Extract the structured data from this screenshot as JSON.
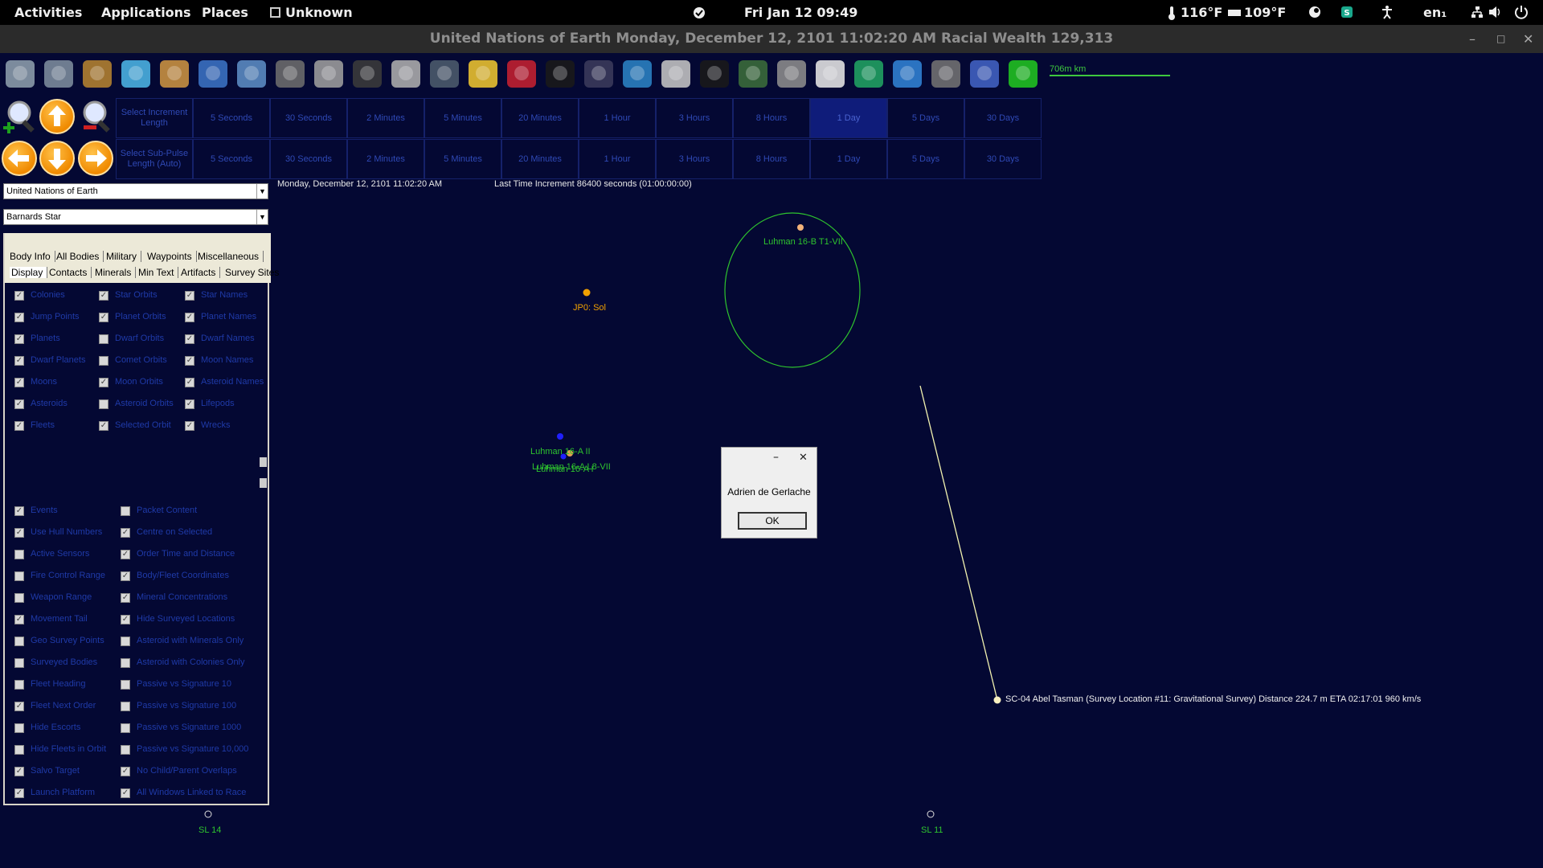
{
  "topbar": {
    "activities": "Activities",
    "applications": "Applications",
    "places": "Places",
    "window_app": "Unknown",
    "clock": "Fri Jan 12  09:49",
    "temp1": "116°F",
    "temp2": "109°F",
    "lang": "en₁"
  },
  "window": {
    "title": "United Nations of Earth   Monday, December 12, 2101 11:02:20 AM   Racial Wealth 129,313"
  },
  "scale": {
    "label": "706m km"
  },
  "toolbar_icons": [
    "home-icon",
    "industry-icon",
    "mining-cart-icon",
    "research-flask-icon",
    "wealth-bag-icon",
    "blueprint-icon",
    "design-icon",
    "ship-icon",
    "missile-icon",
    "ground-unit-icon",
    "walker-icon",
    "commander-icon",
    "medal-star-icon",
    "flag-uk-icon",
    "system-map-icon",
    "galaxy-icon",
    "planet-earth-icon",
    "alien-icon",
    "eye-icon",
    "intel-icon",
    "government-icon",
    "calendar-icon",
    "refresh-icon",
    "save-icon",
    "settings-gear-icon",
    "crystal-ball-icon",
    "green-orb-icon"
  ],
  "time_rows": [
    {
      "label": "Select Increment Length",
      "cells": [
        "5 Seconds",
        "30 Seconds",
        "2 Minutes",
        "5 Minutes",
        "20 Minutes",
        "1 Hour",
        "3 Hours",
        "8 Hours",
        "1 Day",
        "5 Days",
        "30 Days"
      ],
      "selected": 8
    },
    {
      "label": "Select Sub-Pulse Length (Auto)",
      "cells": [
        "5 Seconds",
        "30 Seconds",
        "2 Minutes",
        "5 Minutes",
        "20 Minutes",
        "1 Hour",
        "3 Hours",
        "8 Hours",
        "1 Day",
        "5 Days",
        "30 Days"
      ],
      "selected": -1
    }
  ],
  "selectors": {
    "race": "United Nations of Earth",
    "system": "Barnards Star"
  },
  "status": {
    "date": "Monday, December 12, 2101 11:02:20 AM",
    "increment": "Last Time Increment 86400 seconds (01:00:00:00)"
  },
  "tabs_row1": [
    "Body Info",
    "All Bodies",
    "Military",
    "Waypoints",
    "Miscellaneous"
  ],
  "tabs_row2": [
    "Display",
    "Contacts",
    "Minerals",
    "Min Text",
    "Artifacts",
    "Survey Sites"
  ],
  "display_options": [
    [
      "Colonies",
      "Star Orbits",
      "Star Names"
    ],
    [
      "Jump Points",
      "Planet Orbits",
      "Planet Names"
    ],
    [
      "Planets",
      "Dwarf Orbits",
      "Dwarf Names"
    ],
    [
      "Dwarf Planets",
      "Comet Orbits",
      "Moon Names"
    ],
    [
      "Moons",
      "Moon Orbits",
      "Asteroid Names"
    ],
    [
      "Asteroids",
      "Asteroid Orbits",
      "Lifepods"
    ],
    [
      "Fleets",
      "Selected Orbit",
      "Wrecks"
    ]
  ],
  "display_checked": [
    [
      true,
      true,
      true
    ],
    [
      true,
      true,
      true
    ],
    [
      true,
      false,
      true
    ],
    [
      true,
      false,
      true
    ],
    [
      true,
      true,
      true
    ],
    [
      true,
      false,
      true
    ],
    [
      true,
      true,
      true
    ]
  ],
  "extra_options": [
    [
      "Events",
      "Packet Content"
    ],
    [
      "Use Hull Numbers",
      "Centre on Selected"
    ],
    [
      "Active Sensors",
      "Order Time and Distance"
    ],
    [
      "Fire Control Range",
      "Body/Fleet Coordinates"
    ],
    [
      "Weapon Range",
      "Mineral Concentrations"
    ],
    [
      "Movement Tail",
      "Hide Surveyed Locations"
    ],
    [
      "Geo Survey Points",
      "Asteroid with Minerals Only"
    ],
    [
      "Surveyed Bodies",
      "Asteroid with Colonies Only"
    ],
    [
      "Fleet Heading",
      "Passive vs Signature 10"
    ],
    [
      "Fleet Next Order",
      "Passive vs Signature 100"
    ],
    [
      "Hide Escorts",
      "Passive vs Signature 1000"
    ],
    [
      "Hide Fleets in Orbit",
      "Passive vs Signature 10,000"
    ],
    [
      "Salvo Target",
      "No Child/Parent Overlaps"
    ],
    [
      "Launch Platform",
      "All Windows Linked to Race"
    ]
  ],
  "extra_checked": [
    [
      true,
      false
    ],
    [
      true,
      true
    ],
    [
      false,
      true
    ],
    [
      false,
      true
    ],
    [
      false,
      true
    ],
    [
      true,
      true
    ],
    [
      false,
      false
    ],
    [
      false,
      false
    ],
    [
      false,
      false
    ],
    [
      true,
      false
    ],
    [
      false,
      false
    ],
    [
      false,
      false
    ],
    [
      true,
      true
    ],
    [
      true,
      true
    ]
  ],
  "map": {
    "jp_sol": "JP0: Sol",
    "lb_vii": "Luhman 16-B T1-VII",
    "la_ii": "Luhman 16-A II",
    "la_i": "Luhman 16-A I",
    "lab_vii": "Luhman 16-A L8-VII",
    "fleet": "SC-04 Abel Tasman  (Survey Location #11: Gravitational Survey)   Distance 224.7 m    ETA 02:17:01    960 km/s",
    "sl14": "SL 14",
    "sl11": "SL 11"
  },
  "dialog": {
    "message": "Adrien de Gerlache",
    "ok": "OK"
  }
}
